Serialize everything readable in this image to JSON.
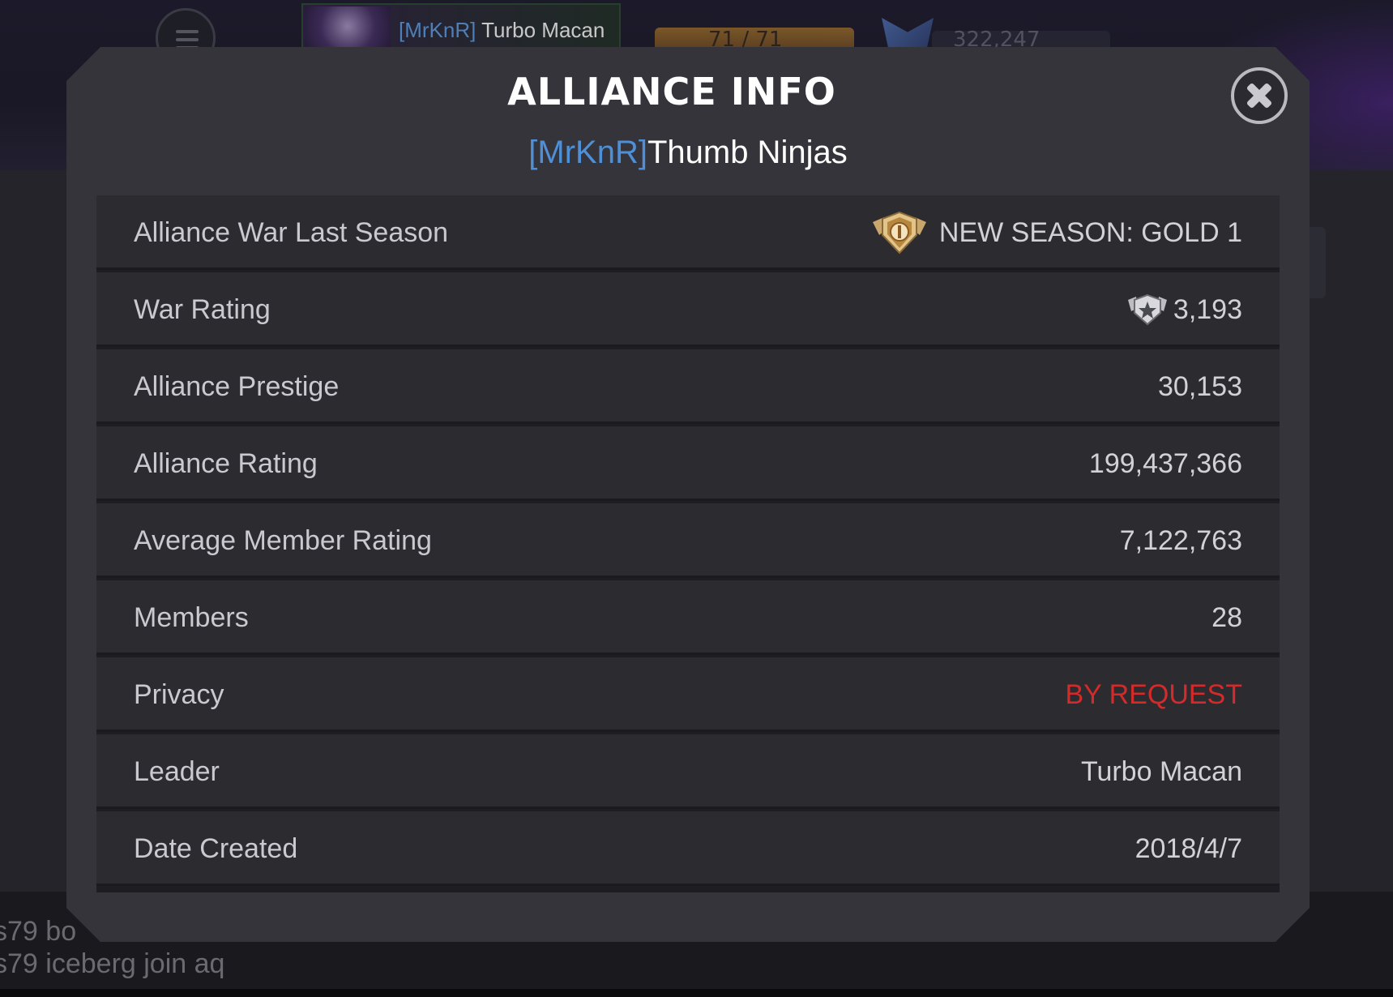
{
  "background": {
    "top_player": {
      "tag": "[MrKnR]",
      "name": "Turbo Macan"
    },
    "top_energy": "71 / 71",
    "top_units": "322,247",
    "chat": [
      {
        "prefix": "s79",
        "text": "bo"
      },
      {
        "prefix": "s79",
        "text": "iceberg join aq"
      }
    ]
  },
  "modal": {
    "title": "ALLIANCE INFO",
    "alliance_tag": "[MrKnR]",
    "alliance_name": "Thumb Ninjas",
    "rows": [
      {
        "label": "Alliance War Last Season",
        "value": "NEW SEASON: GOLD 1",
        "icon": "gold-tier-badge-icon"
      },
      {
        "label": "War Rating",
        "value": "3,193",
        "icon": "war-rating-icon"
      },
      {
        "label": "Alliance Prestige",
        "value": "30,153"
      },
      {
        "label": "Alliance Rating",
        "value": "199,437,366"
      },
      {
        "label": "Average Member Rating",
        "value": "7,122,763"
      },
      {
        "label": "Members",
        "value": "28"
      },
      {
        "label": "Privacy",
        "value": "BY REQUEST",
        "color": "#d42a2a"
      },
      {
        "label": "Leader",
        "value": "Turbo Macan"
      },
      {
        "label": "Date Created",
        "value": "2018/4/7"
      }
    ]
  },
  "colors": {
    "accent_tag": "#4f8fd6",
    "privacy_red": "#d42a2a",
    "modal_bg": "#34343a",
    "row_bg": "#2b2b30"
  }
}
